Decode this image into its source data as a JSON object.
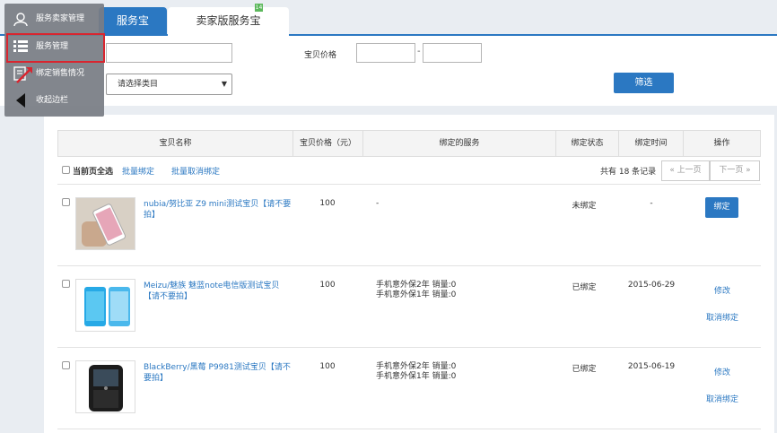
{
  "tabs": [
    {
      "label": "服务宝"
    },
    {
      "label": "卖家版服务宝",
      "flag": "14"
    }
  ],
  "filter": {
    "price_label": "宝贝价格",
    "price_separator": "-",
    "category_select": "请选择类目",
    "filter_button": "筛选"
  },
  "table": {
    "headers": [
      "宝贝名称",
      "宝贝价格（元）",
      "绑定的服务",
      "绑定状态",
      "绑定时间",
      "操作"
    ],
    "select_all_label": "当前页全选",
    "batch_bind": "批量绑定",
    "batch_unbind": "批量取消绑定",
    "records_text": "共有 18 条记录",
    "prev_page": "« 上一页",
    "next_page": "下一页 »",
    "rows": [
      {
        "name": "nubia/努比亚 Z9 mini测试宝贝【请不要拍】",
        "price": "100",
        "services": [
          "-"
        ],
        "status": "未绑定",
        "date": "-",
        "actions": [
          "绑定"
        ]
      },
      {
        "name": "Meizu/魅族 魅蓝note电信版测试宝贝【请不要拍】",
        "price": "100",
        "services": [
          "手机意外保2年 销量:0",
          "手机意外保1年 销量:0"
        ],
        "status": "已绑定",
        "date": "2015-06-29",
        "actions": [
          "修改",
          "取消绑定"
        ]
      },
      {
        "name": "BlackBerry/黑莓 P9981测试宝贝【请不要拍】",
        "price": "100",
        "services": [
          "手机意外保2年 销量:0",
          "手机意外保1年 销量:0"
        ],
        "status": "已绑定",
        "date": "2015-06-19",
        "actions": [
          "修改",
          "取消绑定"
        ]
      }
    ]
  },
  "menu": {
    "items": [
      {
        "label": "服务卖家管理",
        "icon": "user-icon"
      },
      {
        "label": "服务管理",
        "icon": "list-icon"
      },
      {
        "label": "绑定销售情况",
        "icon": "edit-icon"
      },
      {
        "label": "收起边栏",
        "icon": "collapse-arrow-icon"
      }
    ]
  },
  "colors": {
    "primary": "#2b78c2",
    "highlight": "#d9252f"
  }
}
